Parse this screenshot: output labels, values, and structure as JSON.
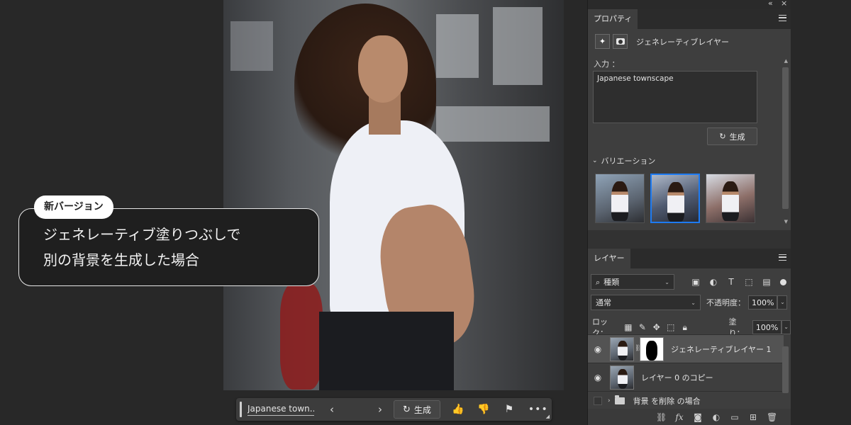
{
  "callout": {
    "badge": "新バージョン",
    "line1": "ジェネレーティブ塗りつぶしで",
    "line2": "別の背景を生成した場合"
  },
  "taskbar": {
    "prompt": "Japanese town...",
    "generate_label": "生成",
    "prev_icon": "chevron-left-icon",
    "next_icon": "chevron-right-icon",
    "more_icon": "more-icon"
  },
  "topbar": {
    "collapse": "«",
    "close": "×"
  },
  "properties": {
    "tab": "プロパティ",
    "layer_kind": "ジェネレーティブレイヤー",
    "input_label": "入力 ：",
    "prompt": "Japanese townscape",
    "generate_label": "生成",
    "variations_label": "バリエーション",
    "variations": [
      {
        "name": "variation-1",
        "selected": false
      },
      {
        "name": "variation-2",
        "selected": true
      },
      {
        "name": "variation-3",
        "selected": false
      }
    ]
  },
  "layers": {
    "tab": "レイヤー",
    "filter": "種類",
    "blend_mode": "通常",
    "opacity_label": "不透明度：",
    "opacity": "100%",
    "lock_label": "ロック：",
    "fill_label": "塗り：",
    "fill": "100%",
    "items": [
      {
        "name": "ジェネレーティブレイヤー 1",
        "selected": true
      },
      {
        "name": "レイヤー 0 のコピー",
        "selected": false
      },
      {
        "name": "背景 を削除 の場合",
        "selected": false
      }
    ]
  },
  "colors": {
    "accent": "#1e7bf2",
    "panel": "#3e3e3e",
    "background": "#282828"
  }
}
